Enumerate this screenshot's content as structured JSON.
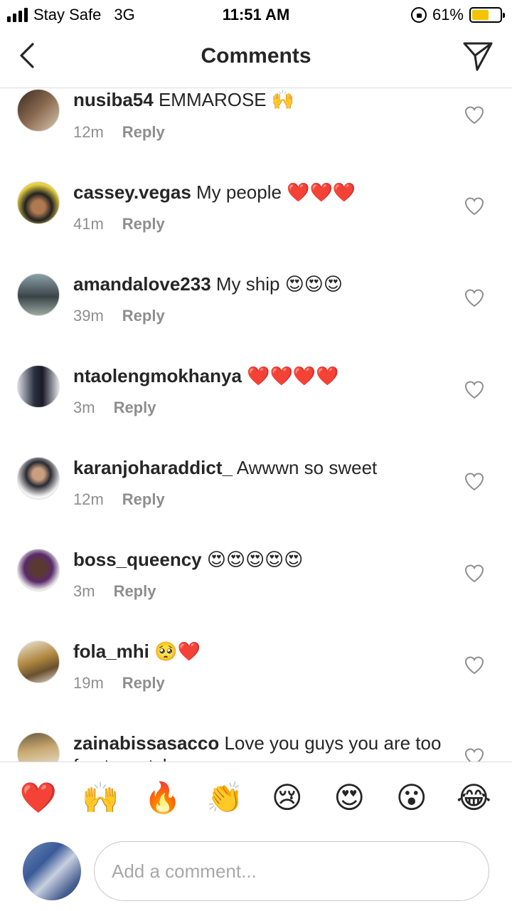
{
  "status_bar": {
    "carrier": "Stay Safe",
    "network": "3G",
    "time": "11:51 AM",
    "battery": "61%",
    "battery_level": 0.61,
    "battery_color": "#f5c400"
  },
  "header": {
    "title": "Comments",
    "back_icon": "chevron-left-icon",
    "send_icon": "paper-plane-icon"
  },
  "comments": [
    {
      "username": "nusiba54",
      "text": " EMMAROSE 🙌",
      "time": "12m",
      "reply_label": "Reply"
    },
    {
      "username": "cassey.vegas",
      "text": " My people ❤️❤️❤️",
      "time": "41m",
      "reply_label": "Reply"
    },
    {
      "username": "amandalove233",
      "text": " My ship 😍😍😍",
      "time": "39m",
      "reply_label": "Reply"
    },
    {
      "username": "ntaolengmokhanya",
      "text": " ❤️❤️❤️❤️",
      "time": "3m",
      "reply_label": "Reply"
    },
    {
      "username": "karanjoharaddict_",
      "text": " Awwwn so sweet",
      "time": "12m",
      "reply_label": "Reply"
    },
    {
      "username": "boss_queency",
      "text": " 😍😍😍😍😍",
      "time": "3m",
      "reply_label": "Reply"
    },
    {
      "username": "fola_mhi",
      "text": " 🥺❤️",
      "time": "19m",
      "reply_label": "Reply"
    },
    {
      "username": "zainabissasacco",
      "text": " Love you guys you are too fun to watch",
      "time": "",
      "reply_label": ""
    }
  ],
  "quick_emojis": [
    "❤️",
    "🙌",
    "🔥",
    "👏",
    "😢",
    "😍",
    "😮",
    "😂"
  ],
  "composer": {
    "placeholder": "Add a comment..."
  }
}
